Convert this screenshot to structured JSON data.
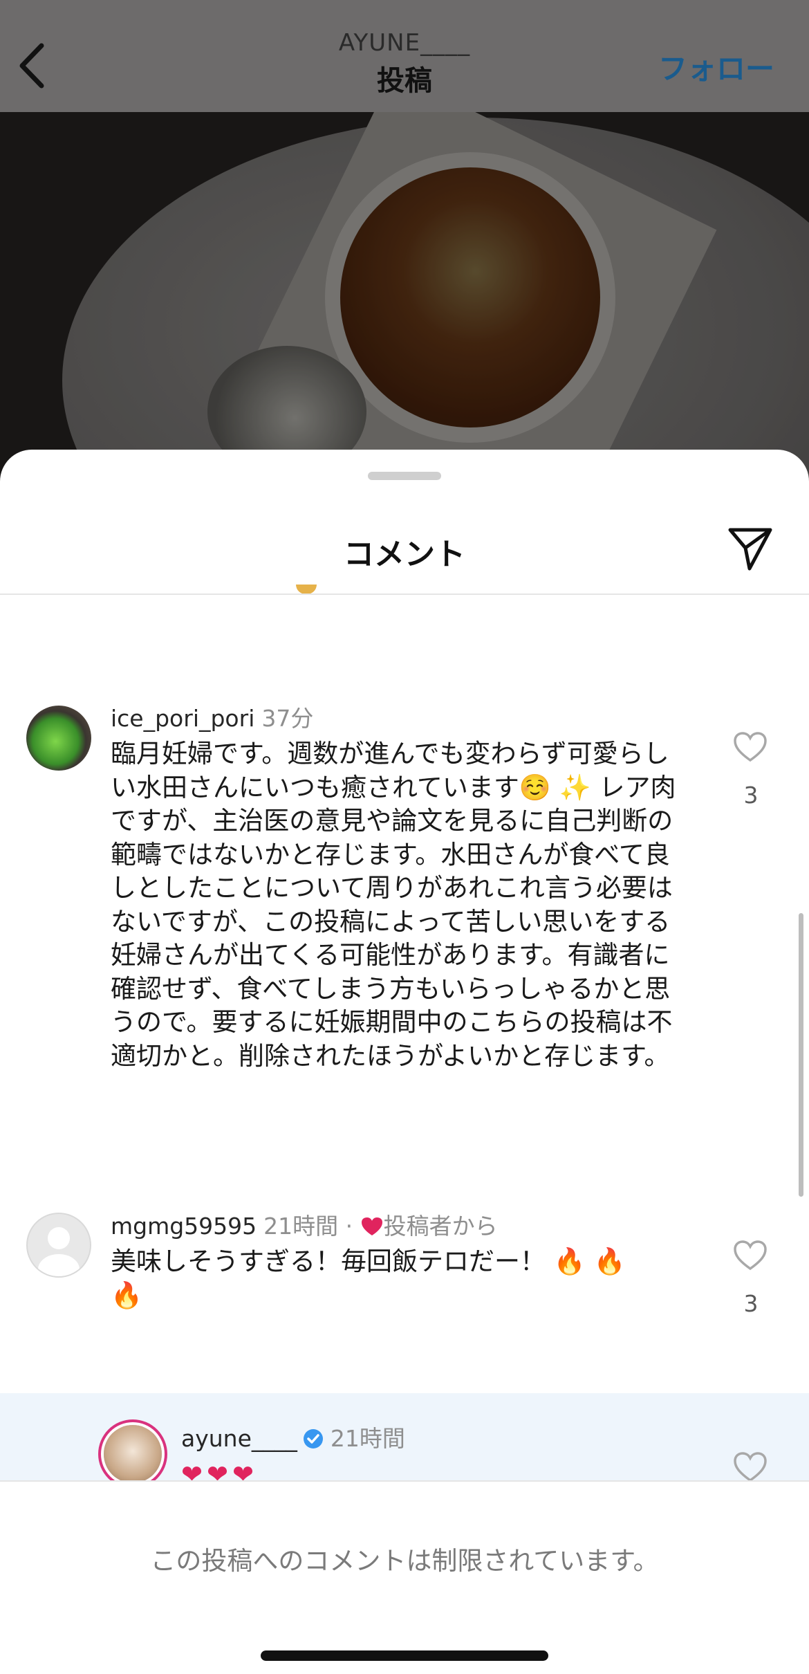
{
  "header": {
    "username": "AYUNE____",
    "title": "投稿",
    "follow_label": "フォロー",
    "back_icon": "chevron-left-icon"
  },
  "sheet": {
    "title": "コメント",
    "send_icon": "paper-plane-icon"
  },
  "comments": [
    {
      "username": "ice_pori_pori",
      "time": "37分",
      "text": "臨月妊婦です。週数が進んでも変わらず可愛らしい水田さんにいつも癒されています☺️ ✨ レア肉ですが、主治医の意見や論文を見るに自己判断の範疇ではないかと存じます。水田さんが食べて良しとしたことについて周りがあれこれ言う必要はないですが、この投稿によって苦しい思いをする妊婦さんが出てくる可能性があります。有識者に確認せず、食べてしまう方もいらっしゃるかと思うので。要するに妊娠期間中のこちらの投稿は不適切かと。削除されたほうがよいかと存じます。",
      "likes": "3"
    },
    {
      "username": "mgmg59595",
      "time": "21時間",
      "creator_badge": "投稿者から",
      "text": "美味しそうすぎる！毎回飯テロだー！ 🔥 🔥 🔥",
      "likes": "3"
    },
    {
      "username": "ayune____",
      "time": "21時間",
      "verified": true,
      "text": "❤❤❤"
    }
  ],
  "footer": {
    "restricted_text": "この投稿へのコメントは制限されています。"
  },
  "colors": {
    "follow": "#1a5b8d",
    "heart_red": "#e0245e",
    "verified_blue": "#3897f0",
    "reply_highlight": "#eef5fc"
  }
}
